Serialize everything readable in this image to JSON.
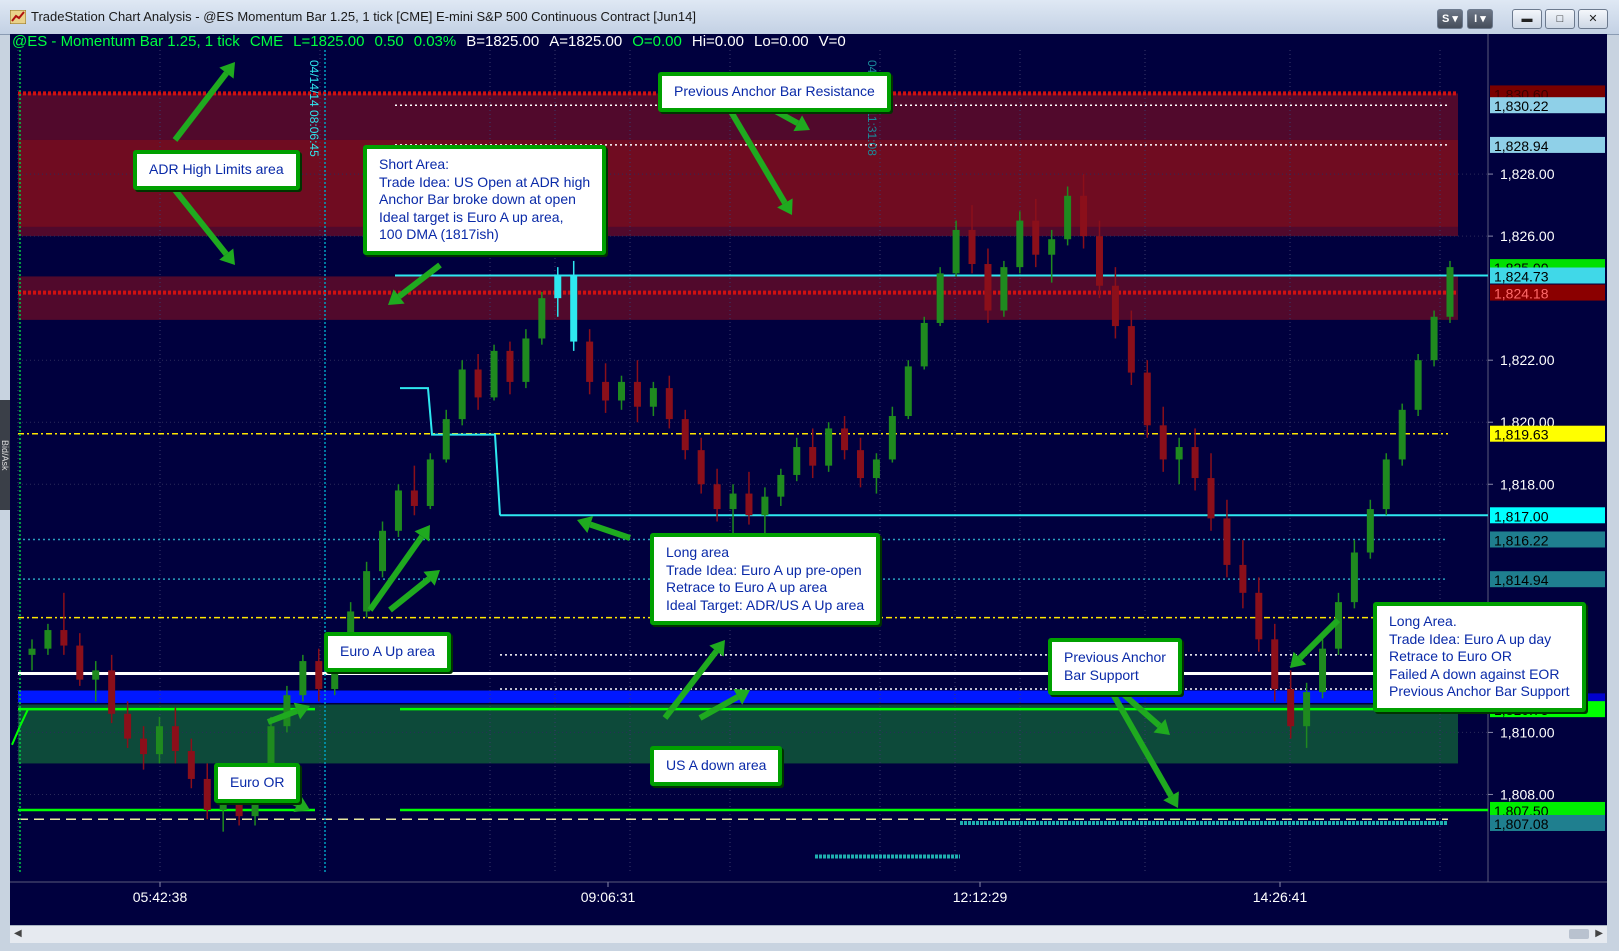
{
  "window": {
    "title": "TradeStation Chart Analysis - @ES Momentum Bar 1.25, 1 tick [CME] E-mini S&P 500 Continuous Contract [Jun14]",
    "buttons": [
      "S",
      "I",
      "minimize",
      "maximize",
      "close"
    ]
  },
  "symbol_bar": {
    "symbol": "@ES - Momentum Bar 1.25, 1 tick",
    "exchange": "CME",
    "last": "L=1825.00",
    "change": "0.50",
    "change_pct": "0.03%",
    "bid": "B=1825.00",
    "ask": "A=1825.00",
    "open": "O=0.00",
    "high": "Hi=0.00",
    "low": "Lo=0.00",
    "volume": "V=0"
  },
  "side_tab": "Bid/Ask",
  "colors": {
    "background": "#00003e",
    "up_bar": "#1f8a1f",
    "down_bar": "#8b0f1a",
    "resistance_zone": "#6b0d2a",
    "support_zone": "#0d4a3a",
    "cyan": "#2ee8f0",
    "yellow": "#ffe600",
    "callout_border": "#00a000",
    "callout_text": "#0a2aa8"
  },
  "chart_data": {
    "type": "candlestick",
    "ylim": [
      1805.5,
      1832.0
    ],
    "y_ticks": [
      1808.0,
      1810.0,
      1818.0,
      1820.0,
      1822.0,
      1826.0,
      1828.0
    ],
    "x_tick_labels": [
      "05:42:38",
      "09:06:31",
      "12:12:29",
      "14:26:41"
    ],
    "last_price": 1825.0,
    "price_labels": [
      {
        "value": 1830.6,
        "text": "1,830.60",
        "color": "#7a0000",
        "text_color": "#3a0000"
      },
      {
        "value": 1830.22,
        "text": "1,830.22",
        "color": "#8fd0e8",
        "text_color": "#000000"
      },
      {
        "value": 1828.94,
        "text": "1,828.94",
        "color": "#8fd0e8",
        "text_color": "#000000"
      },
      {
        "value": 1825.0,
        "text": "1,825.00",
        "color": "#00e000",
        "text_color": "#000000"
      },
      {
        "value": 1824.73,
        "text": "1,824.73",
        "color": "#40d8e8",
        "text_color": "#000000"
      },
      {
        "value": 1824.18,
        "text": "1,824.18",
        "color": "#8b0000",
        "text_color": "#ff6a6a"
      },
      {
        "value": 1819.63,
        "text": "1,819.63",
        "color": "#ffff00",
        "text_color": "#000000"
      },
      {
        "value": 1817.0,
        "text": "1,817.00",
        "color": "#00ffff",
        "text_color": "#000000"
      },
      {
        "value": 1816.22,
        "text": "1,816.22",
        "color": "#1f7f8f",
        "text_color": "#000000"
      },
      {
        "value": 1814.94,
        "text": "1,814.94",
        "color": "#1f7f8f",
        "text_color": "#000000"
      },
      {
        "value": 1811.0,
        "text": "1,811.00",
        "color": "#0000cc",
        "text_color": "#000000"
      },
      {
        "value": 1810.75,
        "text": "1,810.75",
        "color": "#00ff00",
        "text_color": "#000000"
      },
      {
        "value": 1807.5,
        "text": "1,807.50",
        "color": "#00ee00",
        "text_color": "#000000"
      },
      {
        "value": 1807.08,
        "text": "1,807.08",
        "color": "#1f7f8f",
        "text_color": "#000000"
      }
    ],
    "time_stamps_vertical": [
      "04/14/14 08:06:45",
      "04/14/14 11:31:08"
    ],
    "bars": [
      [
        1812.5,
        1813.0,
        1812.0,
        1812.7
      ],
      [
        1812.7,
        1813.5,
        1812.5,
        1813.3
      ],
      [
        1813.3,
        1814.5,
        1812.5,
        1812.8
      ],
      [
        1812.8,
        1813.2,
        1811.5,
        1811.7
      ],
      [
        1811.7,
        1812.3,
        1811.0,
        1812.0
      ],
      [
        1812.0,
        1812.5,
        1810.3,
        1810.6
      ],
      [
        1810.6,
        1811.0,
        1809.5,
        1809.8
      ],
      [
        1809.8,
        1810.2,
        1808.8,
        1809.3
      ],
      [
        1809.3,
        1810.5,
        1809.0,
        1810.2
      ],
      [
        1810.2,
        1810.8,
        1809.0,
        1809.4
      ],
      [
        1809.4,
        1809.8,
        1808.2,
        1808.5
      ],
      [
        1808.5,
        1809.0,
        1807.2,
        1807.5
      ],
      [
        1807.5,
        1808.5,
        1806.8,
        1808.0
      ],
      [
        1808.0,
        1808.3,
        1807.0,
        1807.3
      ],
      [
        1807.3,
        1809.0,
        1807.0,
        1808.7
      ],
      [
        1808.7,
        1810.5,
        1808.5,
        1810.2
      ],
      [
        1810.2,
        1811.5,
        1810.0,
        1811.2
      ],
      [
        1811.2,
        1812.5,
        1811.0,
        1812.3
      ],
      [
        1812.3,
        1812.7,
        1811.0,
        1811.4
      ],
      [
        1811.4,
        1813.0,
        1811.2,
        1812.8
      ],
      [
        1812.8,
        1814.2,
        1812.5,
        1813.9
      ],
      [
        1813.9,
        1815.5,
        1813.7,
        1815.2
      ],
      [
        1815.2,
        1816.8,
        1815.0,
        1816.5
      ],
      [
        1816.5,
        1818.0,
        1816.3,
        1817.8
      ],
      [
        1817.8,
        1818.6,
        1817.0,
        1817.3
      ],
      [
        1817.3,
        1819.0,
        1817.2,
        1818.8
      ],
      [
        1818.8,
        1820.4,
        1818.7,
        1820.1
      ],
      [
        1820.1,
        1822.0,
        1819.9,
        1821.7
      ],
      [
        1821.7,
        1822.2,
        1820.4,
        1820.8
      ],
      [
        1820.8,
        1822.5,
        1820.7,
        1822.3
      ],
      [
        1822.3,
        1822.6,
        1820.9,
        1821.3
      ],
      [
        1821.3,
        1823.0,
        1821.1,
        1822.7
      ],
      [
        1822.7,
        1824.2,
        1822.5,
        1824.0
      ],
      [
        1824.0,
        1825.0,
        1823.4,
        1824.7
      ],
      [
        1824.7,
        1825.2,
        1822.3,
        1822.6
      ],
      [
        1822.6,
        1823.0,
        1820.9,
        1821.3
      ],
      [
        1821.3,
        1821.9,
        1820.3,
        1820.7
      ],
      [
        1820.7,
        1821.5,
        1820.4,
        1821.3
      ],
      [
        1821.3,
        1822.0,
        1820.0,
        1820.5
      ],
      [
        1820.5,
        1821.3,
        1820.2,
        1821.1
      ],
      [
        1821.1,
        1821.5,
        1819.8,
        1820.1
      ],
      [
        1820.1,
        1820.4,
        1818.8,
        1819.1
      ],
      [
        1819.1,
        1819.5,
        1817.7,
        1818.0
      ],
      [
        1818.0,
        1818.5,
        1816.8,
        1817.2
      ],
      [
        1817.2,
        1818.0,
        1816.2,
        1817.7
      ],
      [
        1817.7,
        1818.4,
        1816.7,
        1817.0
      ],
      [
        1817.0,
        1817.9,
        1816.3,
        1817.6
      ],
      [
        1817.6,
        1818.5,
        1817.3,
        1818.3
      ],
      [
        1818.3,
        1819.5,
        1818.1,
        1819.2
      ],
      [
        1819.2,
        1819.8,
        1818.2,
        1818.6
      ],
      [
        1818.6,
        1820.0,
        1818.4,
        1819.8
      ],
      [
        1819.8,
        1820.2,
        1818.8,
        1819.1
      ],
      [
        1819.1,
        1819.5,
        1817.9,
        1818.2
      ],
      [
        1818.2,
        1819.0,
        1817.7,
        1818.8
      ],
      [
        1818.8,
        1820.5,
        1818.7,
        1820.2
      ],
      [
        1820.2,
        1822.0,
        1820.1,
        1821.8
      ],
      [
        1821.8,
        1823.4,
        1821.7,
        1823.2
      ],
      [
        1823.2,
        1825.0,
        1823.1,
        1824.8
      ],
      [
        1824.8,
        1826.5,
        1824.7,
        1826.2
      ],
      [
        1826.2,
        1827.0,
        1824.8,
        1825.1
      ],
      [
        1825.1,
        1825.6,
        1823.2,
        1823.6
      ],
      [
        1823.6,
        1825.2,
        1823.4,
        1825.0
      ],
      [
        1825.0,
        1826.8,
        1824.8,
        1826.5
      ],
      [
        1826.5,
        1827.2,
        1825.0,
        1825.4
      ],
      [
        1825.4,
        1826.2,
        1824.5,
        1825.9
      ],
      [
        1825.9,
        1827.6,
        1825.7,
        1827.3
      ],
      [
        1827.3,
        1828.0,
        1825.6,
        1826.0
      ],
      [
        1826.0,
        1826.5,
        1824.0,
        1824.4
      ],
      [
        1824.4,
        1825.0,
        1822.7,
        1823.1
      ],
      [
        1823.1,
        1823.6,
        1821.2,
        1821.6
      ],
      [
        1821.6,
        1822.0,
        1819.5,
        1819.9
      ],
      [
        1819.9,
        1820.5,
        1818.4,
        1818.8
      ],
      [
        1818.8,
        1819.5,
        1818.0,
        1819.2
      ],
      [
        1819.2,
        1819.8,
        1817.8,
        1818.2
      ],
      [
        1818.2,
        1819.0,
        1816.5,
        1816.9
      ],
      [
        1816.9,
        1817.5,
        1815.0,
        1815.4
      ],
      [
        1815.4,
        1816.2,
        1814.0,
        1814.5
      ],
      [
        1814.5,
        1815.0,
        1812.6,
        1813.0
      ],
      [
        1813.0,
        1813.5,
        1811.0,
        1811.4
      ],
      [
        1811.4,
        1812.0,
        1809.8,
        1810.2
      ],
      [
        1810.2,
        1811.6,
        1809.5,
        1811.3
      ],
      [
        1811.3,
        1813.0,
        1811.1,
        1812.7
      ],
      [
        1812.7,
        1814.5,
        1812.5,
        1814.2
      ],
      [
        1814.2,
        1816.2,
        1814.0,
        1815.8
      ],
      [
        1815.8,
        1817.5,
        1815.6,
        1817.2
      ],
      [
        1817.2,
        1819.0,
        1817.0,
        1818.8
      ],
      [
        1818.8,
        1820.6,
        1818.6,
        1820.4
      ],
      [
        1820.4,
        1822.2,
        1820.2,
        1822.0
      ],
      [
        1822.0,
        1823.6,
        1821.8,
        1823.4
      ],
      [
        1823.4,
        1825.2,
        1823.2,
        1825.0
      ]
    ]
  },
  "annotations": [
    {
      "lines": [
        "ADR High Limits area"
      ]
    },
    {
      "lines": [
        "Short Area:",
        "Trade Idea: US Open at ADR high",
        "Anchor Bar broke down at open",
        "Ideal target is Euro A up area,",
        "100 DMA (1817ish)"
      ]
    },
    {
      "lines": [
        "Previous Anchor Bar Resistance"
      ]
    },
    {
      "lines": [
        "Long area",
        "Trade Idea: Euro A up pre-open",
        "Retrace to Euro A up area",
        "Ideal Target: ADR/US A Up area"
      ]
    },
    {
      "lines": [
        "Euro A Up area"
      ]
    },
    {
      "lines": [
        "Euro OR"
      ]
    },
    {
      "lines": [
        "US A down area"
      ]
    },
    {
      "lines": [
        "Previous Anchor",
        "Bar Support"
      ]
    },
    {
      "lines": [
        "Long Area.",
        "Trade Idea: Euro A up day",
        "Retrace to Euro OR",
        "Failed A down against EOR",
        "Previous Anchor Bar Support"
      ]
    }
  ]
}
